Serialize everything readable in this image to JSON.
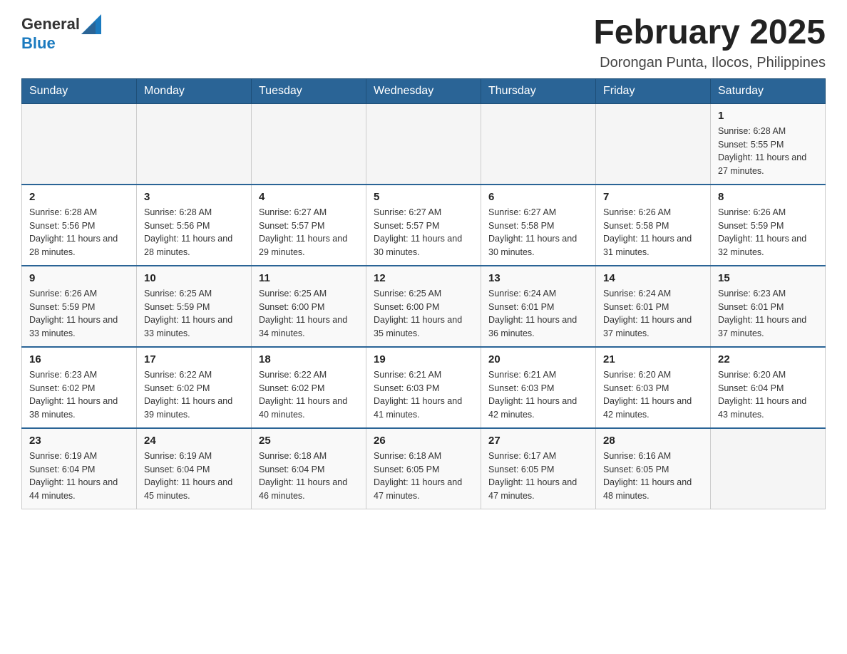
{
  "logo": {
    "general": "General",
    "blue": "Blue"
  },
  "title": "February 2025",
  "location": "Dorongan Punta, Ilocos, Philippines",
  "weekdays": [
    "Sunday",
    "Monday",
    "Tuesday",
    "Wednesday",
    "Thursday",
    "Friday",
    "Saturday"
  ],
  "weeks": [
    [
      {
        "day": "",
        "info": ""
      },
      {
        "day": "",
        "info": ""
      },
      {
        "day": "",
        "info": ""
      },
      {
        "day": "",
        "info": ""
      },
      {
        "day": "",
        "info": ""
      },
      {
        "day": "",
        "info": ""
      },
      {
        "day": "1",
        "info": "Sunrise: 6:28 AM\nSunset: 5:55 PM\nDaylight: 11 hours and 27 minutes."
      }
    ],
    [
      {
        "day": "2",
        "info": "Sunrise: 6:28 AM\nSunset: 5:56 PM\nDaylight: 11 hours and 28 minutes."
      },
      {
        "day": "3",
        "info": "Sunrise: 6:28 AM\nSunset: 5:56 PM\nDaylight: 11 hours and 28 minutes."
      },
      {
        "day": "4",
        "info": "Sunrise: 6:27 AM\nSunset: 5:57 PM\nDaylight: 11 hours and 29 minutes."
      },
      {
        "day": "5",
        "info": "Sunrise: 6:27 AM\nSunset: 5:57 PM\nDaylight: 11 hours and 30 minutes."
      },
      {
        "day": "6",
        "info": "Sunrise: 6:27 AM\nSunset: 5:58 PM\nDaylight: 11 hours and 30 minutes."
      },
      {
        "day": "7",
        "info": "Sunrise: 6:26 AM\nSunset: 5:58 PM\nDaylight: 11 hours and 31 minutes."
      },
      {
        "day": "8",
        "info": "Sunrise: 6:26 AM\nSunset: 5:59 PM\nDaylight: 11 hours and 32 minutes."
      }
    ],
    [
      {
        "day": "9",
        "info": "Sunrise: 6:26 AM\nSunset: 5:59 PM\nDaylight: 11 hours and 33 minutes."
      },
      {
        "day": "10",
        "info": "Sunrise: 6:25 AM\nSunset: 5:59 PM\nDaylight: 11 hours and 33 minutes."
      },
      {
        "day": "11",
        "info": "Sunrise: 6:25 AM\nSunset: 6:00 PM\nDaylight: 11 hours and 34 minutes."
      },
      {
        "day": "12",
        "info": "Sunrise: 6:25 AM\nSunset: 6:00 PM\nDaylight: 11 hours and 35 minutes."
      },
      {
        "day": "13",
        "info": "Sunrise: 6:24 AM\nSunset: 6:01 PM\nDaylight: 11 hours and 36 minutes."
      },
      {
        "day": "14",
        "info": "Sunrise: 6:24 AM\nSunset: 6:01 PM\nDaylight: 11 hours and 37 minutes."
      },
      {
        "day": "15",
        "info": "Sunrise: 6:23 AM\nSunset: 6:01 PM\nDaylight: 11 hours and 37 minutes."
      }
    ],
    [
      {
        "day": "16",
        "info": "Sunrise: 6:23 AM\nSunset: 6:02 PM\nDaylight: 11 hours and 38 minutes."
      },
      {
        "day": "17",
        "info": "Sunrise: 6:22 AM\nSunset: 6:02 PM\nDaylight: 11 hours and 39 minutes."
      },
      {
        "day": "18",
        "info": "Sunrise: 6:22 AM\nSunset: 6:02 PM\nDaylight: 11 hours and 40 minutes."
      },
      {
        "day": "19",
        "info": "Sunrise: 6:21 AM\nSunset: 6:03 PM\nDaylight: 11 hours and 41 minutes."
      },
      {
        "day": "20",
        "info": "Sunrise: 6:21 AM\nSunset: 6:03 PM\nDaylight: 11 hours and 42 minutes."
      },
      {
        "day": "21",
        "info": "Sunrise: 6:20 AM\nSunset: 6:03 PM\nDaylight: 11 hours and 42 minutes."
      },
      {
        "day": "22",
        "info": "Sunrise: 6:20 AM\nSunset: 6:04 PM\nDaylight: 11 hours and 43 minutes."
      }
    ],
    [
      {
        "day": "23",
        "info": "Sunrise: 6:19 AM\nSunset: 6:04 PM\nDaylight: 11 hours and 44 minutes."
      },
      {
        "day": "24",
        "info": "Sunrise: 6:19 AM\nSunset: 6:04 PM\nDaylight: 11 hours and 45 minutes."
      },
      {
        "day": "25",
        "info": "Sunrise: 6:18 AM\nSunset: 6:04 PM\nDaylight: 11 hours and 46 minutes."
      },
      {
        "day": "26",
        "info": "Sunrise: 6:18 AM\nSunset: 6:05 PM\nDaylight: 11 hours and 47 minutes."
      },
      {
        "day": "27",
        "info": "Sunrise: 6:17 AM\nSunset: 6:05 PM\nDaylight: 11 hours and 47 minutes."
      },
      {
        "day": "28",
        "info": "Sunrise: 6:16 AM\nSunset: 6:05 PM\nDaylight: 11 hours and 48 minutes."
      },
      {
        "day": "",
        "info": ""
      }
    ]
  ]
}
